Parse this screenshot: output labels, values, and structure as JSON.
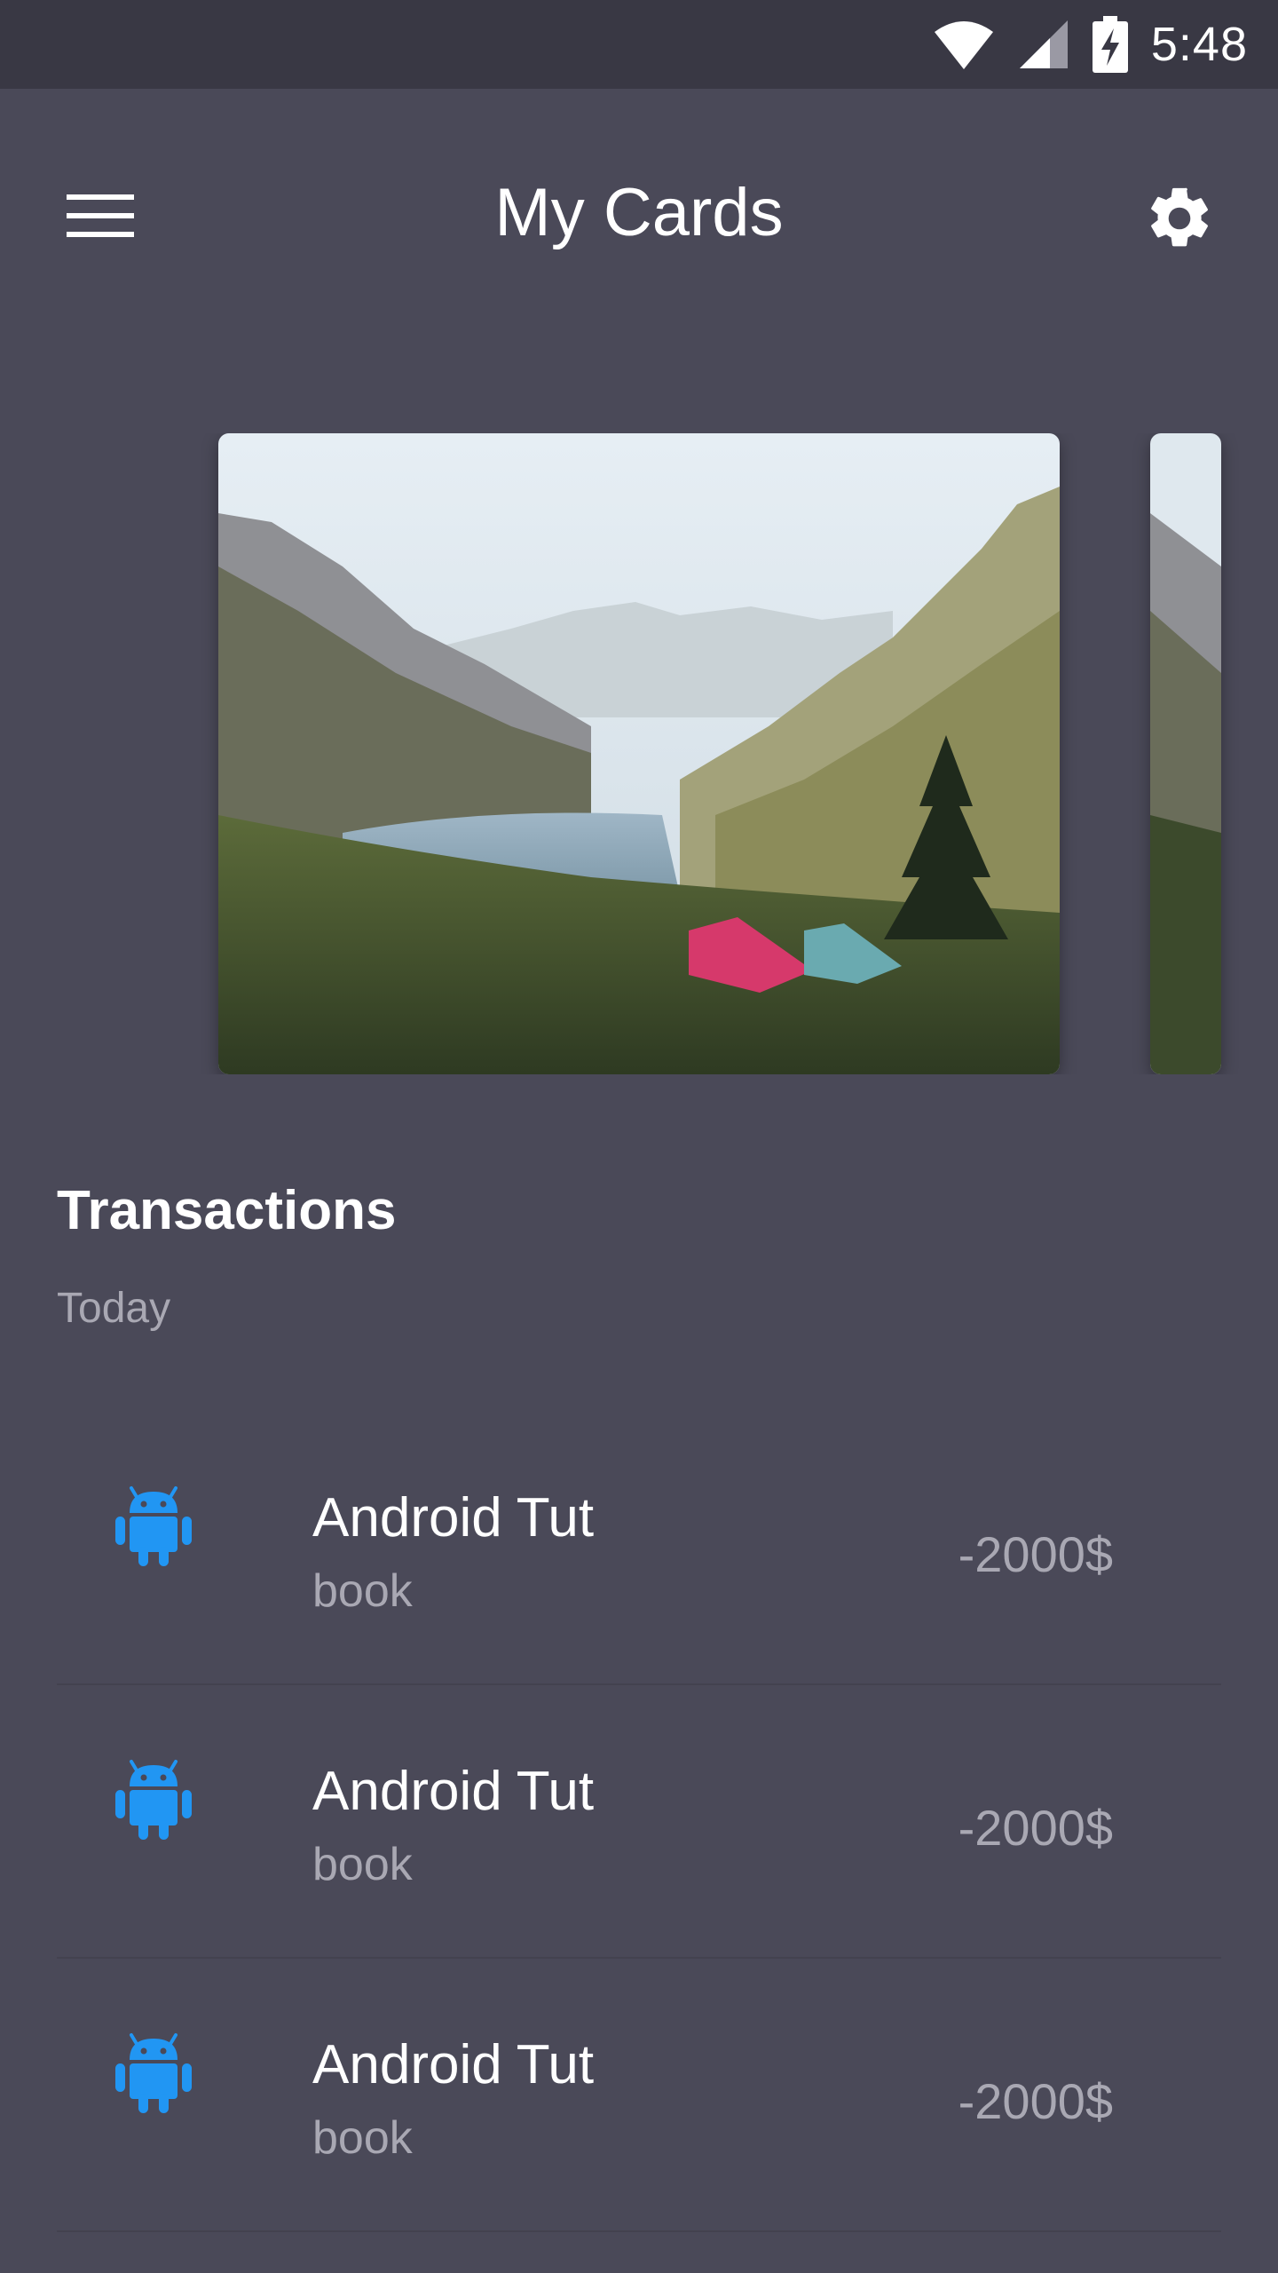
{
  "status_bar": {
    "time": "5:48"
  },
  "app_bar": {
    "title": "My Cards"
  },
  "icons": {
    "menu": "hamburger-menu-icon",
    "settings": "gear-icon",
    "transaction": "android-icon"
  },
  "colors": {
    "background": "#4a4958",
    "status_bar": "#393844",
    "android_blue": "#2196f3",
    "secondary_text": "#a9a8b3"
  },
  "cards": [
    {
      "image": "mountain-lake-camping-photo"
    },
    {
      "image": "mountain-lake-camping-photo"
    }
  ],
  "transactions": {
    "title": "Transactions",
    "subtitle": "Today",
    "items": [
      {
        "title": "Android Tut",
        "subtitle": "book",
        "amount": "-2000$"
      },
      {
        "title": "Android Tut",
        "subtitle": "book",
        "amount": "-2000$"
      },
      {
        "title": "Android Tut",
        "subtitle": "book",
        "amount": "-2000$"
      }
    ]
  }
}
